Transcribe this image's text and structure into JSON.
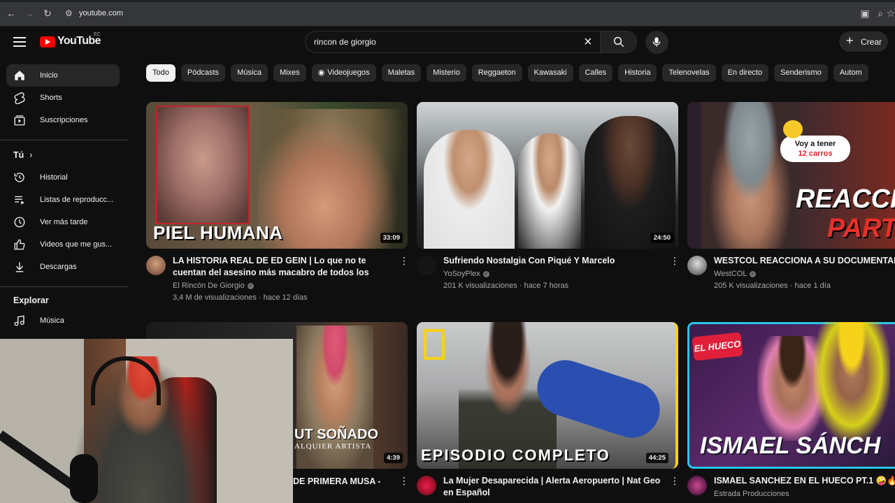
{
  "browser": {
    "url": "youtube.com"
  },
  "header": {
    "logo_text": "YouTube",
    "country_code": "EC",
    "search_query": "rincon de giorgio",
    "create_label": "Crear"
  },
  "sidebar": {
    "main": [
      {
        "label": "Inicio",
        "icon": "home-icon"
      },
      {
        "label": "Shorts",
        "icon": "shorts-icon"
      },
      {
        "label": "Suscripciones",
        "icon": "subscriptions-icon"
      }
    ],
    "you_title": "Tú",
    "you": [
      {
        "label": "Historial",
        "icon": "history-icon"
      },
      {
        "label": "Listas de reproducc...",
        "icon": "playlist-icon"
      },
      {
        "label": "Ver más tarde",
        "icon": "clock-icon"
      },
      {
        "label": "Videos que me gus...",
        "icon": "thumbs-up-icon"
      },
      {
        "label": "Descargas",
        "icon": "download-icon"
      }
    ],
    "explore_title": "Explorar",
    "explore": [
      {
        "label": "Música",
        "icon": "music-icon"
      }
    ]
  },
  "chips": [
    "Todo",
    "Pódcasts",
    "Música",
    "Mixes",
    "Videojuegos",
    "Maletas",
    "Misterio",
    "Reggaeton",
    "Kawasaki",
    "Calles",
    "Historia",
    "Telenovelas",
    "En directo",
    "Senderismo",
    "Autom"
  ],
  "videos": [
    {
      "title": "LA HISTORIA REAL DE ED GEIN | Lo que no te cuentan del asesino más macabro de todos los tiempos",
      "channel": "El Rincón De Giorgio",
      "meta": "3,4 M de visualizaciones · hace 12 días",
      "duration": "33:09",
      "overlay": "PIEL HUMANA"
    },
    {
      "title": "Sufriendo Nostalgia Con Piqué Y Marcelo",
      "channel": "YoSoyPlex",
      "meta": "201 K visualizaciones · hace 7 horas",
      "duration": "24:50",
      "overlay": ""
    },
    {
      "title": "WESTCOL REACCIONA A SU DOCUMENTAL P",
      "channel": "WestCOL",
      "meta": "205 K visualizaciones · hace 1 día",
      "duration": "",
      "overlay": "REACCI",
      "overlay2": "PARTE",
      "bubble": "Voy a tener",
      "bubble2": "12 carros"
    },
    {
      "title": "DE PRIMERA MUSA -",
      "channel": "",
      "meta": "",
      "duration": "4:39",
      "overlay": "UT SOÑADO",
      "overlay2": "ALQUIER ARTISTA"
    },
    {
      "title": "La Mujer Desaparecida | Alerta Aeropuerto | Nat Geo en Español",
      "channel": "",
      "meta": "",
      "duration": "44:25",
      "overlay": "EPISODIO COMPLETO"
    },
    {
      "title": "ISMAEL SANCHEZ EN EL HUECO PT.1 🤪🔥",
      "channel": "Estrada Producciones",
      "meta": "",
      "duration": "",
      "overlay": "ISMAEL SÁNCH",
      "badge": "EL HUECO"
    }
  ]
}
